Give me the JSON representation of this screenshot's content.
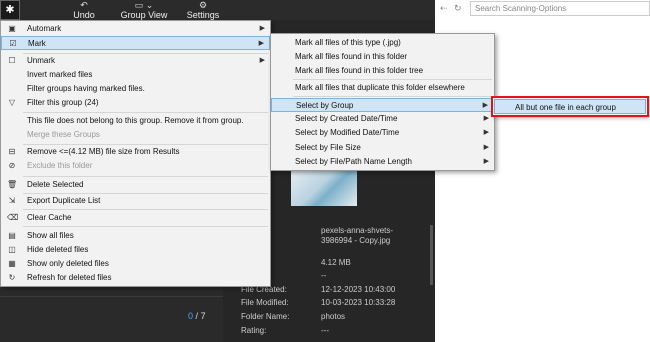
{
  "toolbar": {
    "app_icon": "✱",
    "buttons": [
      {
        "label": "Undo",
        "icon": "undo-icon"
      },
      {
        "label": "Group View",
        "icon": "group-view-icon"
      },
      {
        "label": "Settings",
        "icon": "gear-icon"
      }
    ]
  },
  "search": {
    "placeholder": "Search Scanning-Options"
  },
  "pager": {
    "current": "0",
    "separator": "/",
    "total": "7"
  },
  "details": {
    "title": "es",
    "rows": [
      {
        "key": "e:",
        "value": "pexels-anna-shvets-3986994 - Copy.jpg"
      },
      {
        "key": "",
        "value": "4.12 MB"
      },
      {
        "key": "",
        "value": "--"
      },
      {
        "key": "File Created:",
        "value": "12-12-2023 10:43:00"
      },
      {
        "key": "File Modified:",
        "value": "10-03-2023 10:33:28"
      },
      {
        "key": "Folder Name:",
        "value": "photos"
      },
      {
        "key": "Rating:",
        "value": "---"
      }
    ]
  },
  "main_menu": {
    "items": [
      {
        "label": "Automark",
        "submenu": true
      },
      {
        "label": "Mark",
        "submenu": true
      },
      {
        "label": "Unmark",
        "submenu": true
      },
      {
        "label": "Invert marked files"
      },
      {
        "label": "Filter groups having marked files."
      },
      {
        "label": "Filter this group (24)"
      },
      {
        "label": "This file does not belong to this group. Remove it from group."
      },
      {
        "label": "Merge these Groups"
      },
      {
        "label": "Remove <=(4.12 MB) file size from Results"
      },
      {
        "label": "Exclude this folder"
      },
      {
        "label": "Delete Selected"
      },
      {
        "label": "Export Duplicate List"
      },
      {
        "label": "Clear Cache"
      },
      {
        "label": "Show all files"
      },
      {
        "label": "Hide deleted files"
      },
      {
        "label": "Show only deleted files"
      },
      {
        "label": "Refresh for deleted files"
      }
    ]
  },
  "mark_menu": {
    "items": [
      {
        "label": "Mark all files of this type (.jpg)"
      },
      {
        "label": "Mark all files found in this folder"
      },
      {
        "label": "Mark all files found in this folder tree"
      },
      {
        "label": "Mark all files that duplicate this folder elsewhere"
      },
      {
        "label": "Select by Group"
      },
      {
        "label": "Select by Created Date/Time"
      },
      {
        "label": "Select by Modified Date/Time"
      },
      {
        "label": "Select by File Size"
      },
      {
        "label": "Select by File/Path Name Length"
      }
    ]
  },
  "group_menu": {
    "items": [
      {
        "label": "All but one file in each group"
      }
    ]
  },
  "colors": {
    "highlight": "#cfe4f5",
    "callout": "#e0141e",
    "page_accent": "#4aa3ff"
  }
}
